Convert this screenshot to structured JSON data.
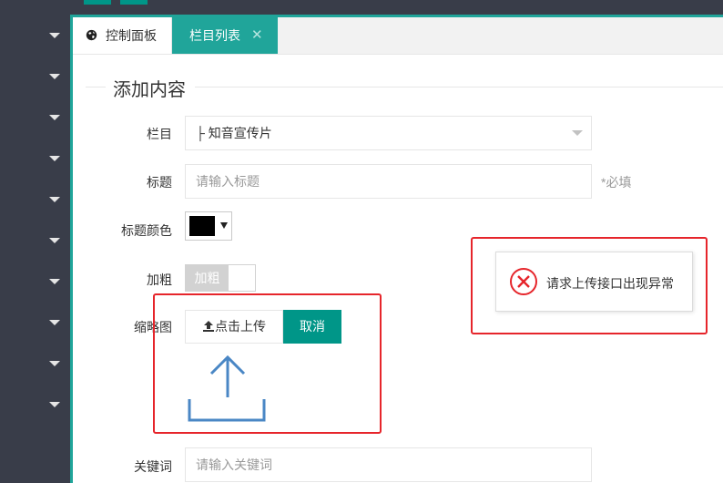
{
  "tabs": [
    {
      "label": "控制面板",
      "icon": "globe-icon"
    },
    {
      "label": "栏目列表",
      "close": "✕"
    }
  ],
  "section": {
    "title": "添加内容"
  },
  "form": {
    "category": {
      "label": "栏目",
      "value": "├ 知音宣传片"
    },
    "title": {
      "label": "标题",
      "placeholder": "请输入标题",
      "hint": "*必填"
    },
    "title_color": {
      "label": "标题颜色",
      "value": "#000000"
    },
    "bold": {
      "label": "加粗",
      "switch_text": "加粗"
    },
    "thumbnail": {
      "label": "缩略图",
      "upload_label": "点击上传",
      "cancel_label": "取消"
    },
    "keywords": {
      "label": "关键词",
      "placeholder": "请输入关键词"
    }
  },
  "toast": {
    "message": "请求上传接口出现异常",
    "icon": "error-x-icon"
  },
  "colors": {
    "sidebar": "#393d49",
    "accent": "#009688",
    "tab_active": "#20a59a",
    "error": "#e6252b",
    "annotation": "#e6252b"
  }
}
